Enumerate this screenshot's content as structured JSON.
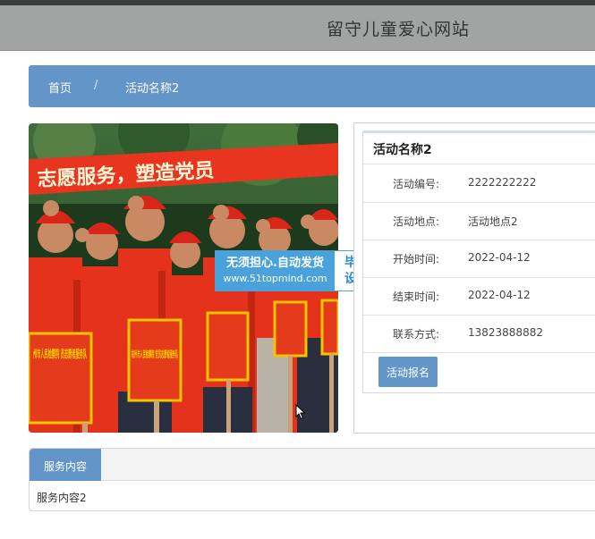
{
  "header": {
    "site_title": "留守儿童爱心网站"
  },
  "breadcrumb": {
    "home": "首页",
    "separator": "/",
    "current": "活动名称2"
  },
  "photo": {
    "banner_text": "志愿服务，塑造党员",
    "placard_left": "州市人民检察院 员志愿者服务队",
    "placard_mid": "杭州市人民检察院 党员志愿者服务队"
  },
  "watermark": {
    "line1": "无须担心.自动发货",
    "line2": "www.51topmind.com",
    "right1": "毕业",
    "right2": "设计"
  },
  "activity": {
    "title": "活动名称2",
    "rows": [
      {
        "label": "活动编号:",
        "value": "2222222222"
      },
      {
        "label": "活动地点:",
        "value": "活动地点2"
      },
      {
        "label": "开始时间:",
        "value": "2022-04-12"
      },
      {
        "label": "结束时间:",
        "value": "2022-04-12"
      },
      {
        "label": "联系方式:",
        "value": "13823888882"
      }
    ],
    "signup_label": "活动报名"
  },
  "service": {
    "tab_label": "服务内容",
    "content": "服务内容2"
  },
  "colors": {
    "accent": "#6495c9",
    "header_bg": "#a2a4a3",
    "banner_red": "#e8351f"
  }
}
